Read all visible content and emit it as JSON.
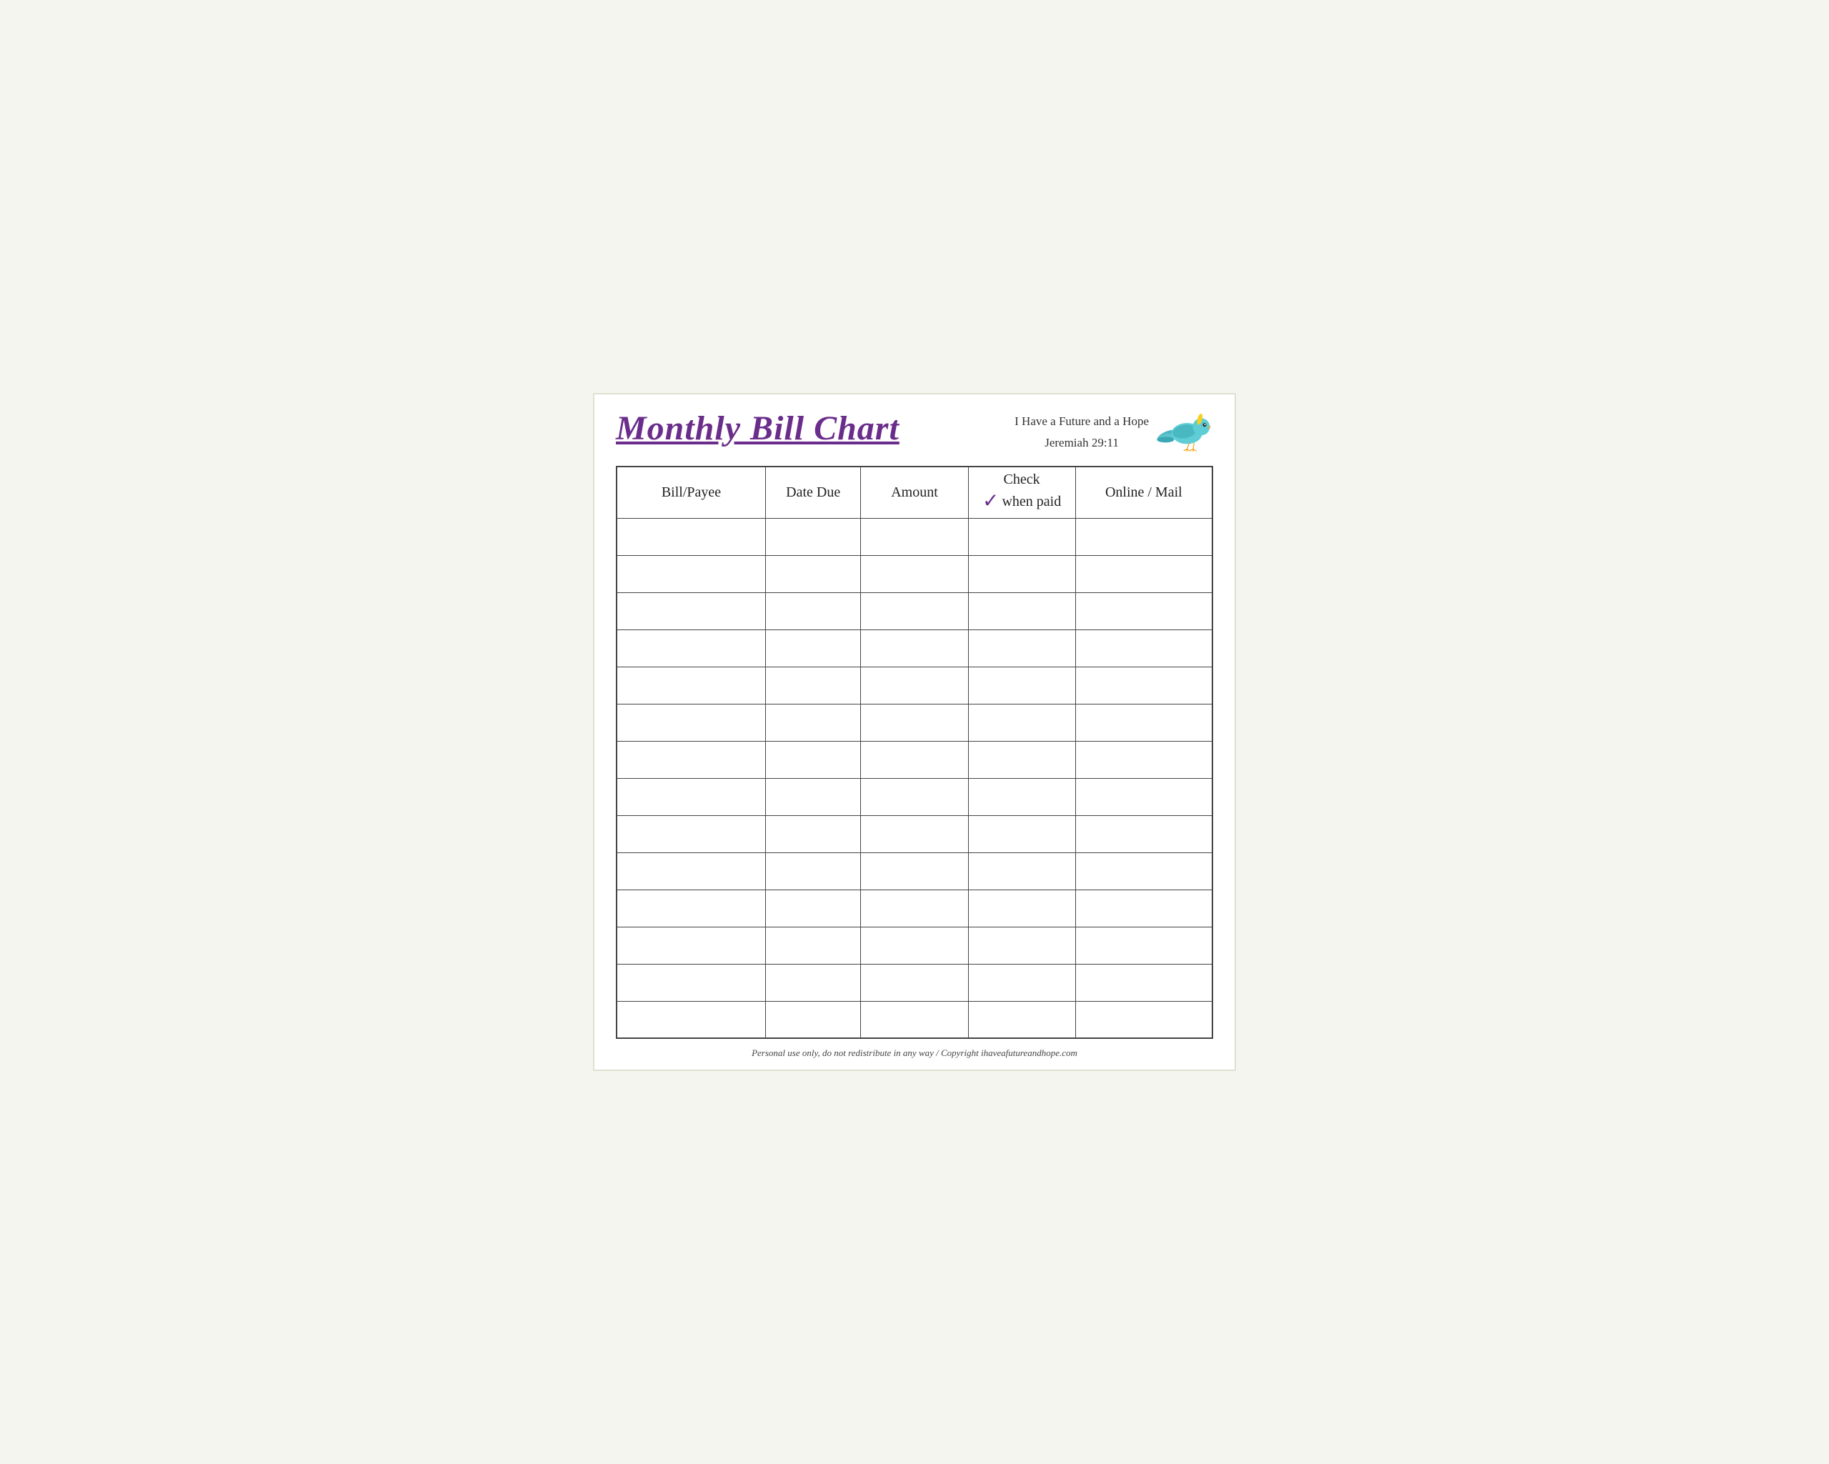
{
  "header": {
    "title": "Monthly Bill Chart",
    "scripture_line1": "I Have a Future and a Hope",
    "scripture_line2": "Jeremiah 29:11"
  },
  "table": {
    "columns": [
      {
        "key": "bill_payee",
        "label": "Bill/Payee"
      },
      {
        "key": "date_due",
        "label": "Date Due"
      },
      {
        "key": "amount",
        "label": "Amount"
      },
      {
        "key": "check_when_paid",
        "label_line1": "Check",
        "label_line2": "when paid",
        "checkmark": "✓"
      },
      {
        "key": "online_mail",
        "label": "Online / Mail"
      }
    ],
    "row_count": 14
  },
  "footer": {
    "text": "Personal use only, do not redistribute in any way / Copyright ihaveafutureandhope.com"
  }
}
